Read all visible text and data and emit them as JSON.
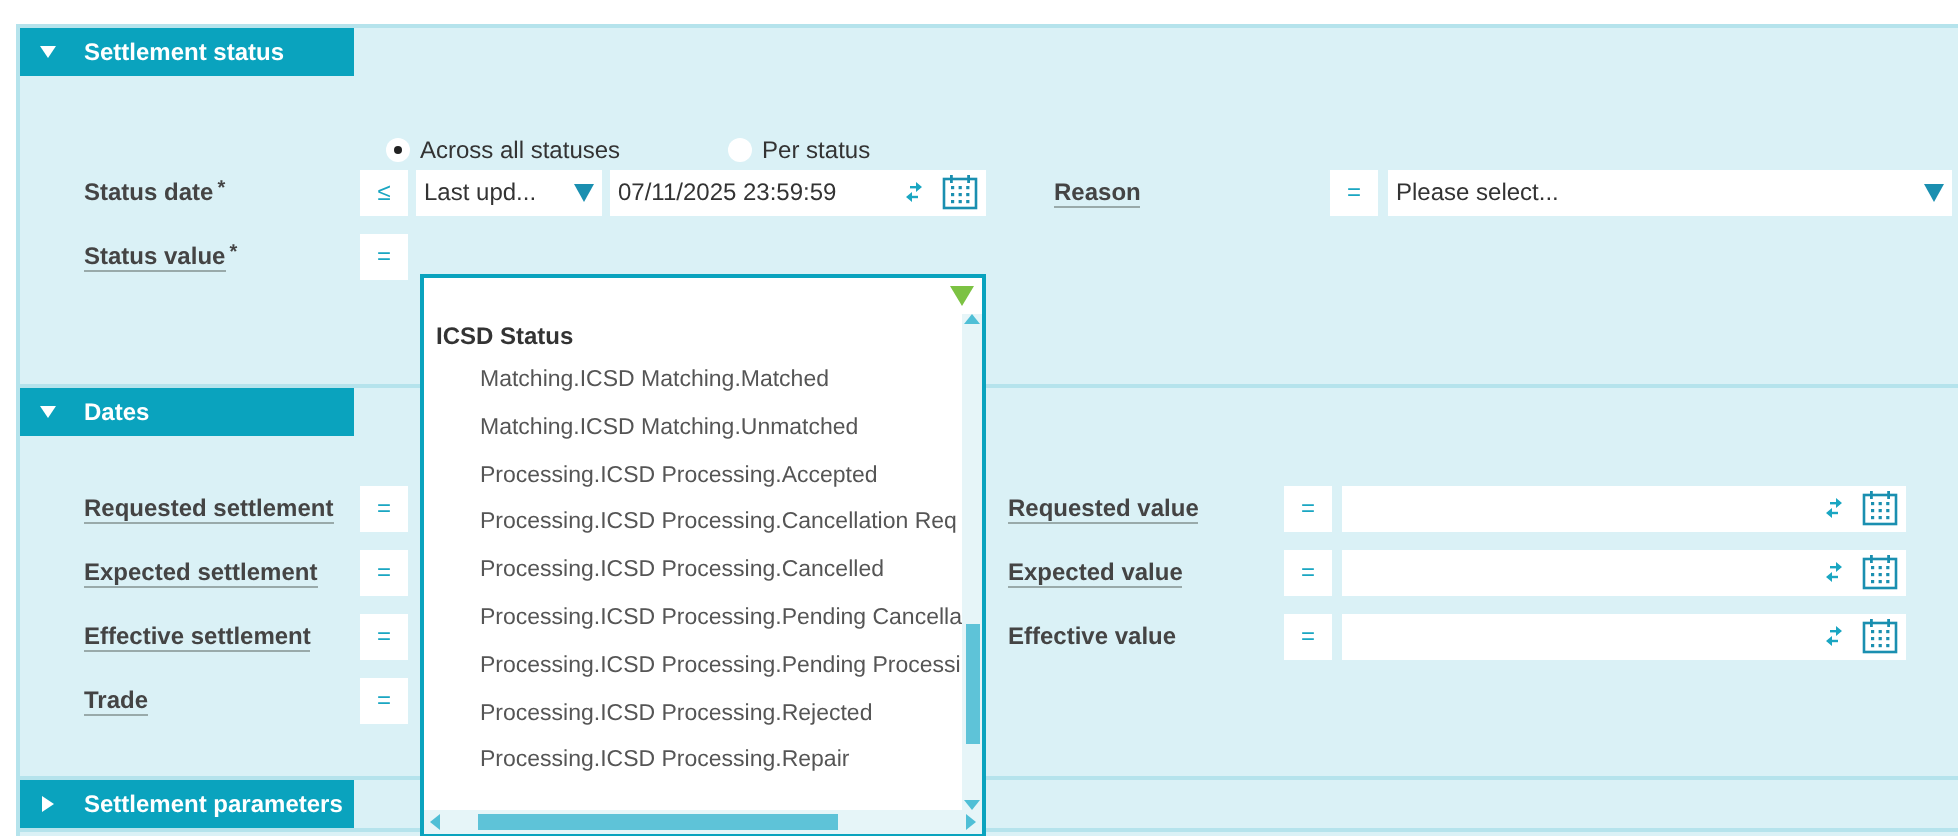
{
  "settlement_status": {
    "title": "Settlement status",
    "expanded": true,
    "scope_options": [
      {
        "label": "Across all statuses",
        "selected": true
      },
      {
        "label": "Per status",
        "selected": false
      }
    ],
    "status_date": {
      "label": "Status date",
      "underlined": false,
      "required_mark": "*",
      "operator": "≤",
      "type_value": "Last upd...",
      "date_value": "07/11/2025 23:59:59"
    },
    "status_value": {
      "label": "Status value",
      "underlined": true,
      "required_mark": "*",
      "operator": "="
    },
    "reason": {
      "label": "Reason",
      "underlined": true,
      "operator": "=",
      "placeholder": "Please select..."
    }
  },
  "dates": {
    "title": "Dates",
    "expanded": true,
    "left_rows": [
      {
        "label": "Requested settlement",
        "underlined": true,
        "operator": "="
      },
      {
        "label": "Expected settlement",
        "underlined": true,
        "operator": "="
      },
      {
        "label": "Effective settlement",
        "underlined": true,
        "operator": "="
      },
      {
        "label": "Trade",
        "underlined": true,
        "operator": "="
      }
    ],
    "right_rows": [
      {
        "label": "Requested value",
        "underlined": true,
        "operator": "="
      },
      {
        "label": "Expected value",
        "underlined": true,
        "operator": "="
      },
      {
        "label": "Effective value",
        "underlined": false,
        "operator": "="
      }
    ]
  },
  "settlement_parameters": {
    "title": "Settlement parameters",
    "expanded": false
  },
  "status_dropdown": {
    "group": "ICSD Status",
    "items": [
      "Matching.ICSD Matching.Matched",
      "Matching.ICSD Matching.Unmatched",
      "Processing.ICSD Processing.Accepted",
      "Processing.ICSD Processing.Cancellation Req",
      "Processing.ICSD Processing.Cancelled",
      "Processing.ICSD Processing.Pending Cancella",
      "Processing.ICSD Processing.Pending Processi",
      "Processing.ICSD Processing.Rejected",
      "Processing.ICSD Processing.Repair"
    ]
  }
}
